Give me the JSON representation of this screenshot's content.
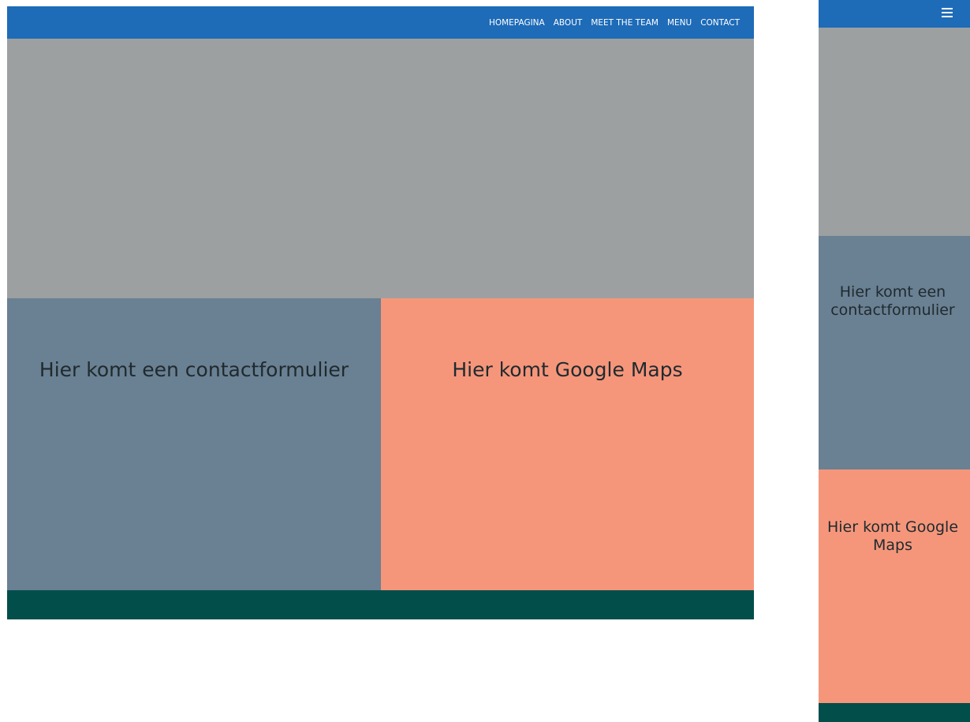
{
  "colors": {
    "nav": "#1e6bb8",
    "hero": "#9ca0a1",
    "contact_panel": "#6a8093",
    "maps_panel": "#f5967b",
    "footer": "#024e4b"
  },
  "desktop": {
    "nav": {
      "items": [
        {
          "label": "HOMEPAGINA"
        },
        {
          "label": "ABOUT"
        },
        {
          "label": "MEET THE TEAM"
        },
        {
          "label": "MENU"
        },
        {
          "label": "CONTACT"
        }
      ]
    },
    "contact_text": "Hier komt een contactformulier",
    "maps_text": "Hier komt Google Maps"
  },
  "mobile": {
    "menu_icon": "hamburger-menu-icon",
    "contact_text": "Hier komt een contactformulier",
    "maps_text": "Hier komt Google Maps"
  }
}
